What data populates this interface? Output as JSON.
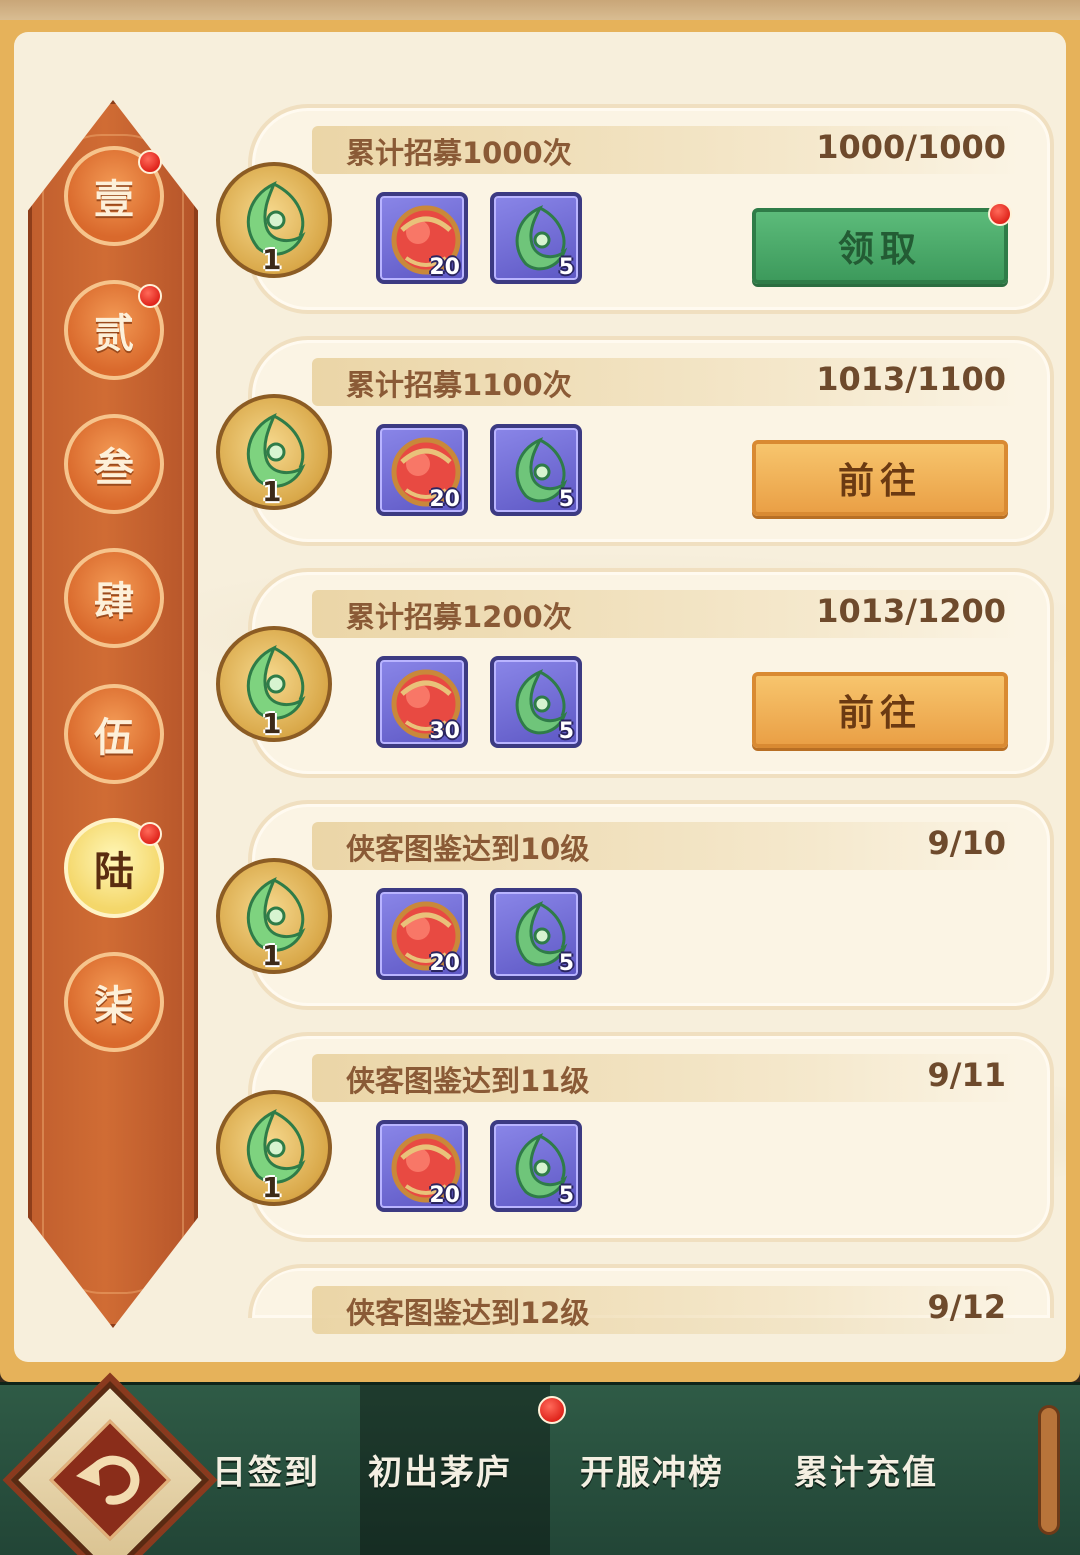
{
  "sidebar": {
    "tabs": [
      {
        "label": "壹",
        "active": false,
        "badge": true
      },
      {
        "label": "贰",
        "active": false,
        "badge": true
      },
      {
        "label": "叁",
        "active": false,
        "badge": false
      },
      {
        "label": "肆",
        "active": false,
        "badge": false
      },
      {
        "label": "伍",
        "active": false,
        "badge": false
      },
      {
        "label": "陆",
        "active": true,
        "badge": true
      },
      {
        "label": "柒",
        "active": false,
        "badge": false
      }
    ]
  },
  "quests": [
    {
      "title": "累计招募1000次",
      "progress": "1000/1000",
      "medal_count": "1",
      "rewards": [
        {
          "icon": "red-orb-icon",
          "qty": "20"
        },
        {
          "icon": "jade-token-icon",
          "qty": "5"
        }
      ],
      "button": {
        "label": "领取",
        "style": "claim",
        "badge": true
      }
    },
    {
      "title": "累计招募1100次",
      "progress": "1013/1100",
      "medal_count": "1",
      "rewards": [
        {
          "icon": "red-orb-icon",
          "qty": "20"
        },
        {
          "icon": "jade-token-icon",
          "qty": "5"
        }
      ],
      "button": {
        "label": "前往",
        "style": "go",
        "badge": false
      }
    },
    {
      "title": "累计招募1200次",
      "progress": "1013/1200",
      "medal_count": "1",
      "rewards": [
        {
          "icon": "red-orb-icon",
          "qty": "30"
        },
        {
          "icon": "jade-token-icon",
          "qty": "5"
        }
      ],
      "button": {
        "label": "前往",
        "style": "go",
        "badge": false
      }
    },
    {
      "title": "侠客图鉴达到10级",
      "progress": "9/10",
      "medal_count": "1",
      "rewards": [
        {
          "icon": "red-orb-icon",
          "qty": "20"
        },
        {
          "icon": "jade-token-icon",
          "qty": "5"
        }
      ],
      "button": null
    },
    {
      "title": "侠客图鉴达到11级",
      "progress": "9/11",
      "medal_count": "1",
      "rewards": [
        {
          "icon": "red-orb-icon",
          "qty": "20"
        },
        {
          "icon": "jade-token-icon",
          "qty": "5"
        }
      ],
      "button": null
    },
    {
      "title": "侠客图鉴达到12级",
      "progress": "9/12"
    }
  ],
  "bottom_nav": {
    "items": [
      "日签到",
      "初出茅庐",
      "开服冲榜",
      "累计充值"
    ],
    "badge_on": "初出茅庐"
  },
  "colors": {
    "claim_green": "#3d9a5c",
    "go_orange": "#eaa046",
    "badge_red": "#e0251c",
    "sidebar_brown": "#c15f2e"
  }
}
